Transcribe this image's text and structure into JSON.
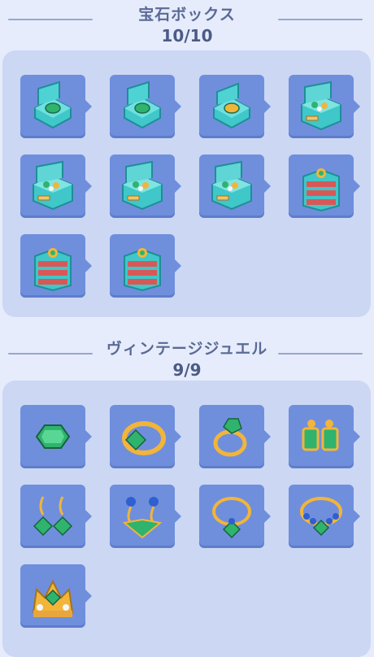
{
  "sections": [
    {
      "title": "宝石ボックス",
      "count": "10/10",
      "items": [
        "jewelry-box-1-icon",
        "jewelry-box-2-icon",
        "jewelry-box-3-icon",
        "jewelry-box-4-icon",
        "jewelry-box-5-icon",
        "jewelry-box-6-icon",
        "jewelry-box-7-icon",
        "jewelry-box-8-icon",
        "jewelry-box-9-icon",
        "jewelry-box-10-icon"
      ]
    },
    {
      "title": "ヴィンテージジュエル",
      "count": "9/9",
      "items": [
        "emerald-gem-icon",
        "emerald-ring-icon",
        "gold-ring-icon",
        "emerald-earrings-icon",
        "drop-earrings-icon",
        "sapphire-earrings-icon",
        "emerald-necklace-icon",
        "sapphire-necklace-icon",
        "jeweled-crown-icon"
      ]
    }
  ],
  "colors": {
    "background": "#e6ecfb",
    "panel": "#ccd7f4",
    "slot": "#6f8fdd",
    "title": "#5a6a96",
    "teal": "#3fc7c9",
    "gold": "#f2b53a",
    "emerald": "#2fb36d"
  }
}
